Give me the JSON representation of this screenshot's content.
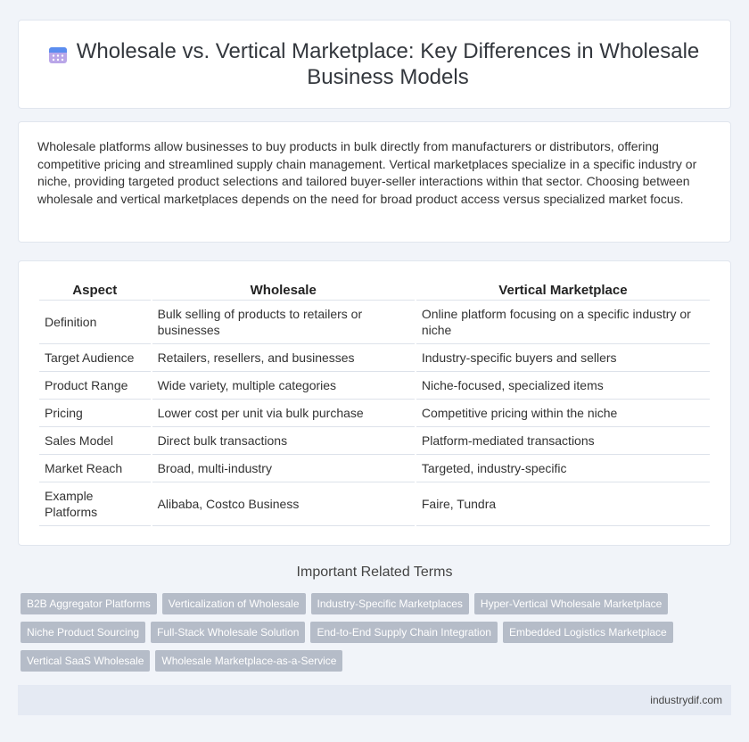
{
  "header": {
    "title": "Wholesale vs. Vertical Marketplace: Key Differences in Wholesale Business Models",
    "icon": "calendar-icon"
  },
  "intro": {
    "text": "Wholesale platforms allow businesses to buy products in bulk directly from manufacturers or distributors, offering competitive pricing and streamlined supply chain management. Vertical marketplaces specialize in a specific industry or niche, providing targeted product selections and tailored buyer-seller interactions within that sector. Choosing between wholesale and vertical marketplaces depends on the need for broad product access versus specialized market focus."
  },
  "table": {
    "headers": [
      "Aspect",
      "Wholesale",
      "Vertical Marketplace"
    ],
    "rows": [
      [
        "Definition",
        "Bulk selling of products to retailers or businesses",
        "Online platform focusing on a specific industry or niche"
      ],
      [
        "Target Audience",
        "Retailers, resellers, and businesses",
        "Industry-specific buyers and sellers"
      ],
      [
        "Product Range",
        "Wide variety, multiple categories",
        "Niche-focused, specialized items"
      ],
      [
        "Pricing",
        "Lower cost per unit via bulk purchase",
        "Competitive pricing within the niche"
      ],
      [
        "Sales Model",
        "Direct bulk transactions",
        "Platform-mediated transactions"
      ],
      [
        "Market Reach",
        "Broad, multi-industry",
        "Targeted, industry-specific"
      ],
      [
        "Example Platforms",
        "Alibaba, Costco Business",
        "Faire, Tundra"
      ]
    ]
  },
  "related": {
    "title": "Important Related Terms",
    "tags": [
      [
        "B2B Aggregator Platforms",
        "Verticalization of Wholesale",
        "Industry-Specific Marketplaces",
        "Hyper-Vertical Wholesale Marketplace"
      ],
      [
        "Niche Product Sourcing",
        "Full-Stack Wholesale Solution",
        "End-to-End Supply Chain Integration",
        "Embedded Logistics Marketplace"
      ],
      [
        "Vertical SaaS Wholesale",
        "Wholesale Marketplace-as-a-Service"
      ]
    ]
  },
  "footer": {
    "site": "industrydif.com"
  },
  "colors": {
    "background": "#f1f4f9",
    "card": "#ffffff",
    "tag": "#b5bcc8",
    "footer": "#e5eaf3"
  }
}
